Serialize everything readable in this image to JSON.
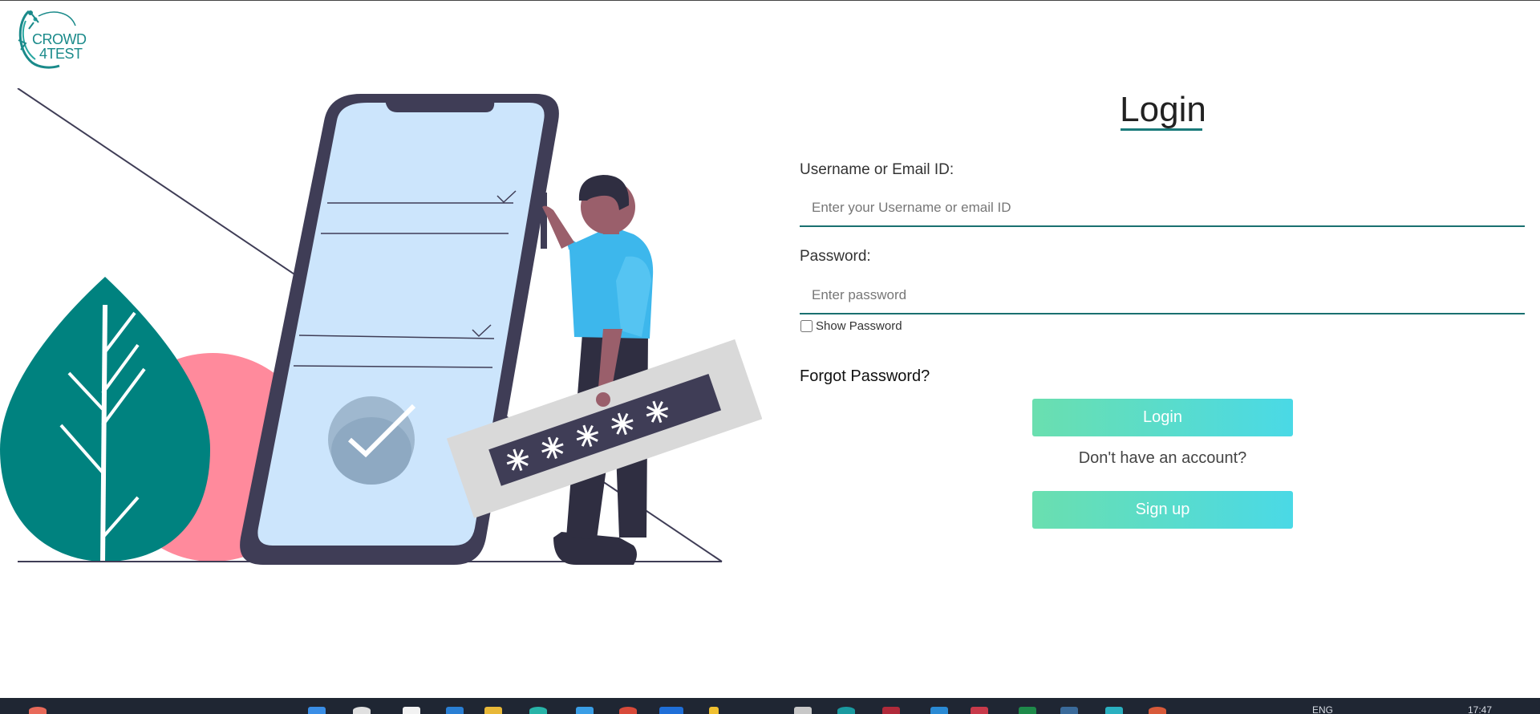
{
  "logo": {
    "line1": "CROWD",
    "line2": "4TEST",
    "color": "#1a8a8a"
  },
  "login": {
    "title": "Login",
    "username_label": "Username or Email ID:",
    "username_placeholder": "Enter your Username or email ID",
    "password_label": "Password:",
    "password_placeholder": "Enter password",
    "show_password_label": "Show Password",
    "forgot_password": "Forgot Password?",
    "login_button": "Login",
    "no_account_text": "Don't have an account?",
    "signup_button": "Sign up"
  },
  "taskbar": {
    "language": "ENG",
    "time": "17:47"
  },
  "colors": {
    "accent": "#1a7070",
    "button_start": "#6adfaf",
    "button_end": "#4ad9e6",
    "leaf": "#00827f",
    "phone_frame": "#3f3d56",
    "phone_screen": "#cce5fc",
    "shirt": "#3db7ec",
    "circle": "#ff8a9c"
  }
}
